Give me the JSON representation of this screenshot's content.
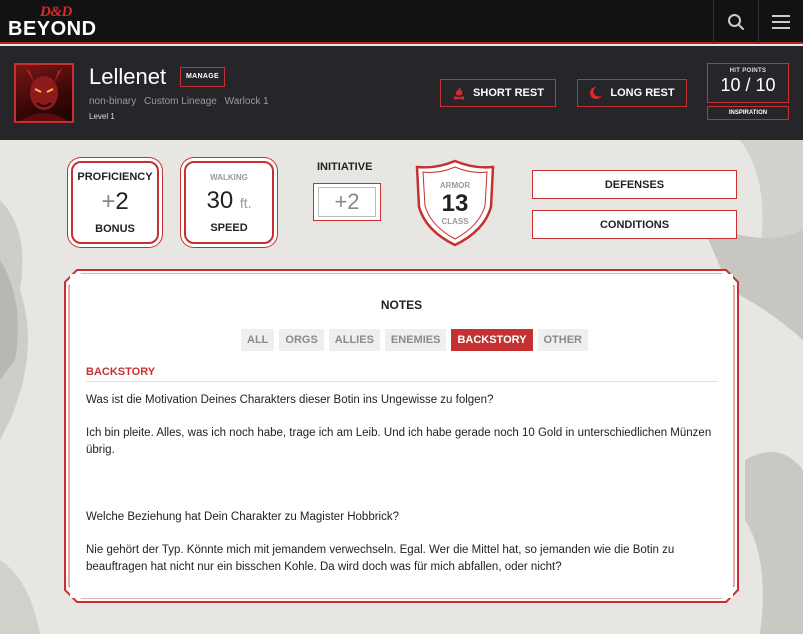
{
  "nav": {
    "logo_dd": "D&D",
    "logo_beyond": "BEYOND",
    "search_icon": "search-icon",
    "menu_icon": "hamburger-menu-icon"
  },
  "character": {
    "name": "Lellenet",
    "manage_label": "MANAGE",
    "gender": "non-binary",
    "race": "Custom Lineage",
    "class_level": "Warlock 1",
    "level": "Level 1"
  },
  "rest": {
    "short_label": "SHORT REST",
    "short_icon": "campfire-icon",
    "long_label": "LONG REST",
    "long_icon": "moon-icon"
  },
  "hit_points": {
    "label": "HIT POINTS",
    "current": 10,
    "max": 10,
    "display": "10 / 10",
    "inspiration_label": "INSPIRATION"
  },
  "stats": {
    "proficiency": {
      "top": "PROFICIENCY",
      "sign": "+",
      "value": "2",
      "bottom": "BONUS"
    },
    "speed": {
      "top": "WALKING",
      "value": "30",
      "unit": "ft.",
      "bottom": "SPEED"
    },
    "initiative": {
      "label": "INITIATIVE",
      "value": "+2"
    },
    "armor": {
      "top": "ARMOR",
      "value": "13",
      "bottom": "CLASS"
    }
  },
  "side_buttons": {
    "defenses": "DEFENSES",
    "conditions": "CONDITIONS"
  },
  "notes": {
    "title": "NOTES",
    "tabs": [
      "ALL",
      "ORGS",
      "ALLIES",
      "ENEMIES",
      "BACKSTORY",
      "OTHER"
    ],
    "active_tab": "BACKSTORY",
    "section_heading": "BACKSTORY",
    "paragraphs": [
      "Was ist die Motivation Deines Charakters dieser Botin ins Ungewisse zu folgen?",
      "Ich bin pleite. Alles, was ich noch habe, trage ich am Leib. Und ich habe gerade noch 10 Gold in unterschiedlichen Münzen übrig.",
      "Welche Beziehung hat Dein Charakter zu Magister Hobbrick?",
      "Nie gehört der Typ. Könnte mich mit jemandem verwechseln. Egal. Wer die Mittel hat, so jemanden wie die Botin zu beauftragen hat nicht nur ein bisschen Kohle. Da wird doch was für mich abfallen, oder nicht?"
    ]
  },
  "colors": {
    "accent": "#c53131",
    "topbar": "#121212",
    "header": "#26262a",
    "background": "#e9e8e4"
  }
}
